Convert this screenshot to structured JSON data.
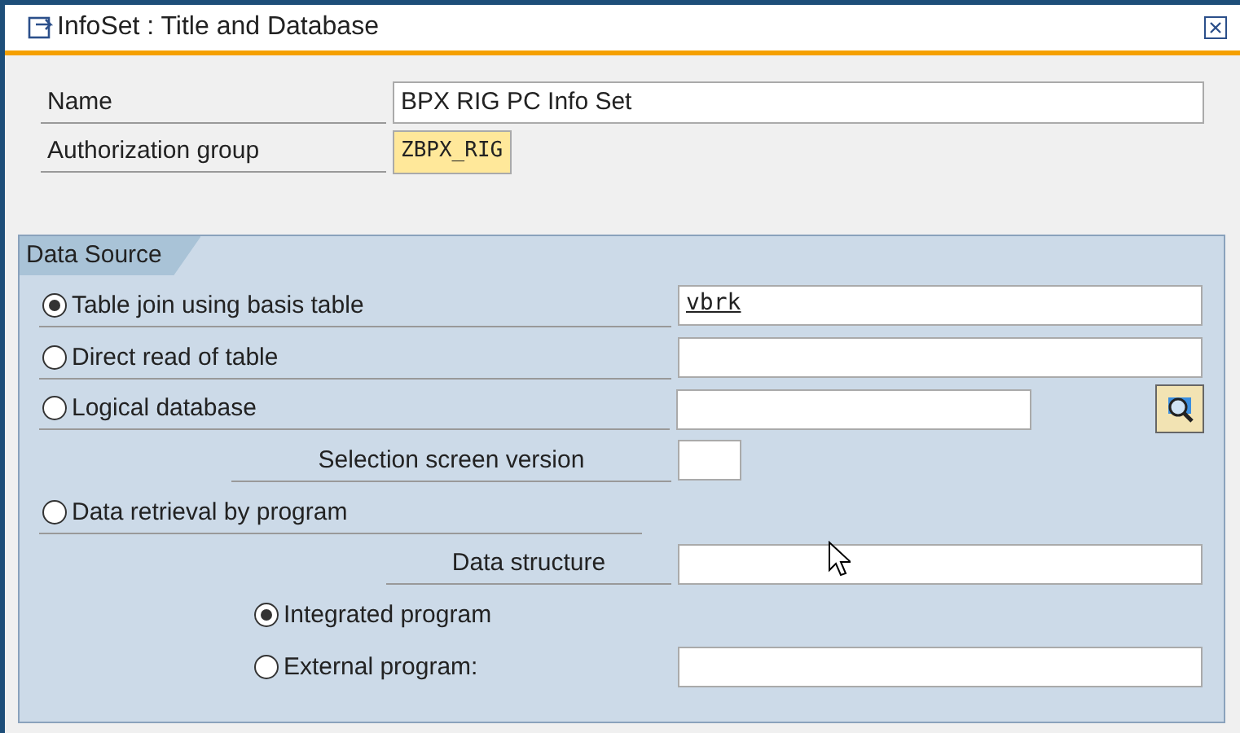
{
  "window": {
    "title": "InfoSet  : Title and Database"
  },
  "header_fields": [
    {
      "label": "Name",
      "value": "BPX RIG PC Info Set",
      "kind": "text"
    },
    {
      "label": "Authorization group",
      "value": "ZBPX_RIG",
      "kind": "highlight"
    }
  ],
  "data_source": {
    "title": "Data Source",
    "rows": [
      {
        "kind": "option",
        "label": "Table join using basis table",
        "selected": true,
        "input": true,
        "value": "vbrk"
      },
      {
        "kind": "option",
        "label": "Direct read of table",
        "selected": false,
        "input": true
      },
      {
        "kind": "option",
        "label": "Logical database",
        "selected": false,
        "input": true,
        "search_button": true
      },
      {
        "kind": "parameter",
        "label": "Selection screen version",
        "input": true
      },
      {
        "kind": "option",
        "label": "Data retrieval by program",
        "selected": false
      },
      {
        "kind": "parameter",
        "label": "Data structure",
        "input": true
      },
      {
        "kind": "sub_option",
        "label": "Integrated program",
        "selected": true
      },
      {
        "kind": "sub_option",
        "label": "External program:",
        "selected": false,
        "input": true
      }
    ]
  }
}
